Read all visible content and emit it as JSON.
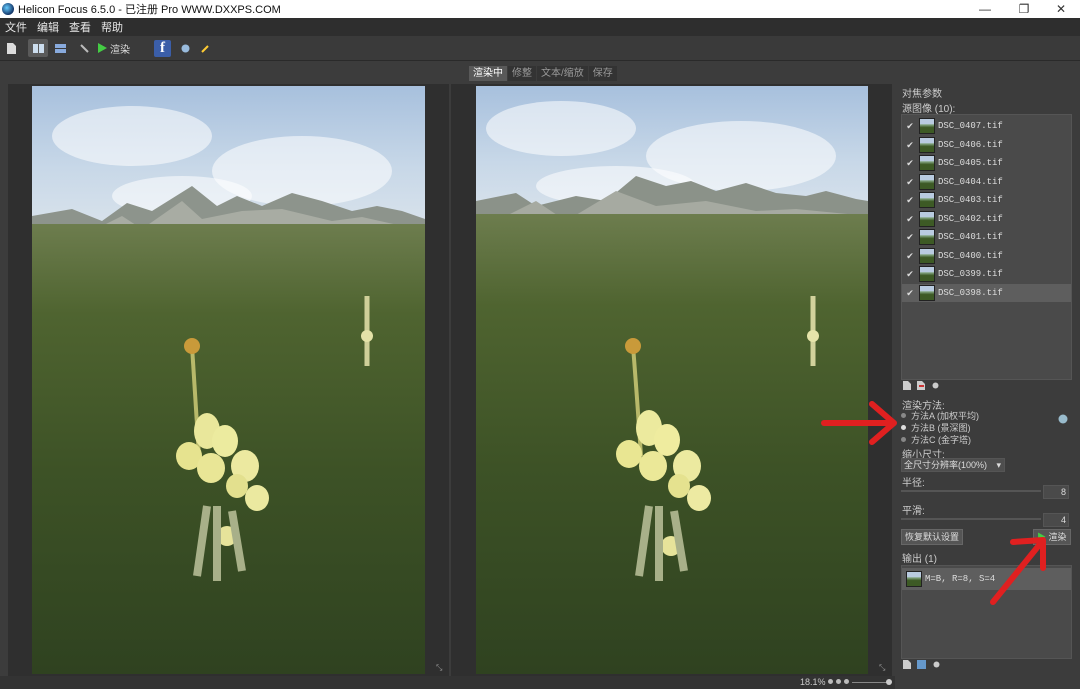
{
  "window": {
    "title": "Helicon Focus 6.5.0 - 已注册 Pro  WWW.DXXPS.COM",
    "controls": [
      "—",
      "❐",
      "✕"
    ]
  },
  "menu": [
    "文件",
    "编辑",
    "查看",
    "帮助"
  ],
  "toolbar": {
    "render_label": "渲染",
    "facebook": "f"
  },
  "tabs": [
    {
      "label": "渲染中",
      "active": true
    },
    {
      "label": "修整"
    },
    {
      "label": "文本/缩放"
    },
    {
      "label": "保存"
    }
  ],
  "panel": {
    "title": "对焦参数",
    "sources_label": "源图像 (10):",
    "files": [
      "DSC_0407.tif",
      "DSC_0406.tif",
      "DSC_0405.tif",
      "DSC_0404.tif",
      "DSC_0403.tif",
      "DSC_0402.tif",
      "DSC_0401.tif",
      "DSC_0400.tif",
      "DSC_0399.tif",
      "DSC_0398.tif"
    ],
    "selected_file": "DSC_0398.tif",
    "method_label": "渲染方法:",
    "methods": [
      {
        "label": "方法A (加权平均)",
        "checked": false
      },
      {
        "label": "方法B (景深图)",
        "checked": true
      },
      {
        "label": "方法C (金字塔)",
        "checked": false
      }
    ],
    "size_label": "缩小尺寸:",
    "size_value": "全尺寸分辨率(100%)",
    "radius_label": "半径:",
    "radius_value": "8",
    "smooth_label": "平滑:",
    "smooth_value": "4",
    "reset_label": "恢复默认设置",
    "render_label": "渲染",
    "output_label": "输出 (1)",
    "output_item": "M=B, R=8, S=4"
  },
  "status": {
    "zoom": "18.1%"
  },
  "colors": {
    "arrow": "#e02020",
    "facebook": "#3b5ea8",
    "background": "#3c3c3c"
  }
}
